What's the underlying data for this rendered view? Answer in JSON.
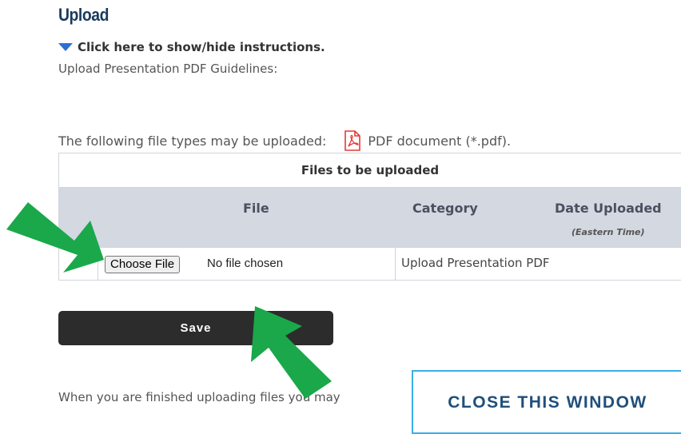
{
  "heading": "Upload",
  "instructions_toggle": "Click here to show/hide instructions.",
  "guidelines_label": "Upload Presentation PDF Guidelines:",
  "file_types": {
    "prefix": "The following file types may be uploaded:",
    "type_label": "PDF document (*.pdf)."
  },
  "table": {
    "title": "Files to be uploaded",
    "headers": {
      "file": "File",
      "category": "Category",
      "date_uploaded": "Date Uploaded",
      "timezone": "(Eastern Time)"
    },
    "row": {
      "choose_label": "Choose File",
      "no_file": "No file chosen",
      "category": "Upload Presentation PDF"
    }
  },
  "save_label": "Save",
  "finished_text": "When you are finished uploading files you may",
  "close_label": "CLOSE THIS WINDOW",
  "colors": {
    "heading": "#1a3a5c",
    "header_bg": "#d3d8e1",
    "save_bg": "#2c2c2c",
    "close_border": "#3ab0e6",
    "arrow": "#1aa84a"
  }
}
